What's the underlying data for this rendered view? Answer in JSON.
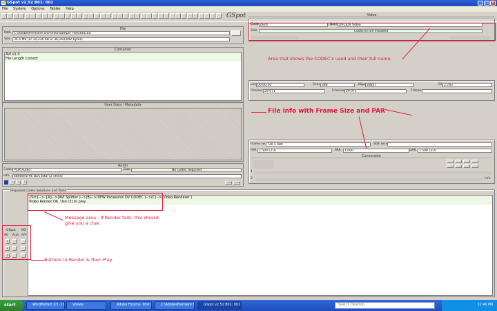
{
  "window": {
    "title": "GSpot v2.52 B01: 001"
  },
  "menu": [
    "File",
    "System",
    "Options",
    "Tables",
    "Help"
  ],
  "logo": "GSpot",
  "file": {
    "title": "File",
    "path_label": "Path",
    "path": "C:\\Adobe\\Premiere Elements\\Sample Files\\001.avi",
    "size_label": "Size",
    "size": "34.4 MB (or 35,316 KB or 36,164,042 bytes)"
  },
  "container": {
    "title": "Container",
    "lines": [
      "AVI v1.0",
      "File Length Correct"
    ]
  },
  "user_data": {
    "title": "User Data / Metadata"
  },
  "audio": {
    "title": "Audio",
    "codec_label": "Codec",
    "codec": "PCM Audio",
    "stat_label": "Stat",
    "stat": "No Codec Required",
    "info_label": "Info",
    "info": "48000Hz  96 kb/s total (2 chnls)",
    "btn_labels": [
      "1",
      "2",
      "3"
    ],
    "extra_buttons": [
      "DMO",
      "WAV"
    ]
  },
  "video": {
    "title": "Video",
    "codec_label": "Codec",
    "codec": "dvsd",
    "name_label": "Name",
    "name": "DVC/DV Video",
    "stat_label": "Stat",
    "stat": "Codec(s) are Installed",
    "len_label": "Len",
    "len": "00:00:10",
    "frms_label": "Frms",
    "frms": "286",
    "kbps_label": "Kbps",
    "kbps": "28827",
    "qf_label": "Qf",
    "qf": "2.783",
    "pics_label": "Pics/sec",
    "pics": "29.971",
    "frms_sec_label": "Frms/sec",
    "frms_sec": "29.971",
    "flds_label": "Flds/sec",
    "flds": "",
    "frame_label": "Frame (w:x)",
    "frame": "720 x 480",
    "sde_label": "SDE (w:x)",
    "far_label": "FAR",
    "far": "1.500 (3:2)",
    "par_label": "PAR",
    "par": "1.000",
    "dar_label": "DAR",
    "dar": "1.500 (3:2)",
    "conversion_label": "Conversion",
    "info_btn": "Info"
  },
  "proposed": {
    "title": "Proposed Codec Solutions and Tests",
    "lines": [
      "{Src}-->-{A}-->(AVI Splitter )-->(B)-->(VFW Panasonic DV CODEC )-->(C)-->(Video Renderer )",
      "Video Render OK. Use [3] to play."
    ],
    "gspot_label": "GSpot",
    "ms_label": "MS",
    "col_labels": [
      "AV",
      "Aud",
      "A/V"
    ],
    "render_buttons": [
      "1",
      "2",
      "3"
    ]
  },
  "annotations": {
    "codec_note": "Area that shows the CODEC's used and their full name",
    "frame_note": "File info with Frame Size and PAR",
    "message_note": "Message area - If Render fails, this should give you a clue.",
    "buttons_note": "Buttons to Render & then Play",
    "color": "#e0143c"
  },
  "taskbar": {
    "start": "start",
    "tasks": [
      "WordPerfect X3 - [Docu...",
      "Vnews",
      "Adobe Forums: Post Rep...",
      "C:\\Adobe\\Premiere Eleme...",
      "GSpot v2.52 B01: 001"
    ],
    "search_placeholder": "Search Desktop",
    "clock": "12:46 PM"
  }
}
